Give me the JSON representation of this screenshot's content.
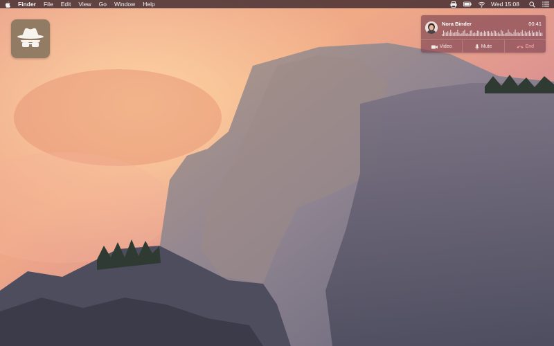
{
  "menubar": {
    "apple_icon": "apple-icon",
    "items": [
      "Finder",
      "File",
      "Edit",
      "View",
      "Go",
      "Window",
      "Help"
    ],
    "status_icons": [
      "printer-icon",
      "battery-icon",
      "wifi-icon"
    ],
    "clock": "Wed 15:08",
    "search_icon": "search-icon",
    "list_icon": "notification-center-icon"
  },
  "desktop": {
    "icon_name": "incognito-app-icon"
  },
  "call": {
    "caller": "Nora Binder",
    "duration": "00:41",
    "actions": {
      "video": "Video",
      "mute": "Mute",
      "end": "End"
    }
  },
  "colors": {
    "menubar_bg": "#2c1c25",
    "call_bg": "#7a3f4e",
    "end_red": "#ff9c9c"
  }
}
